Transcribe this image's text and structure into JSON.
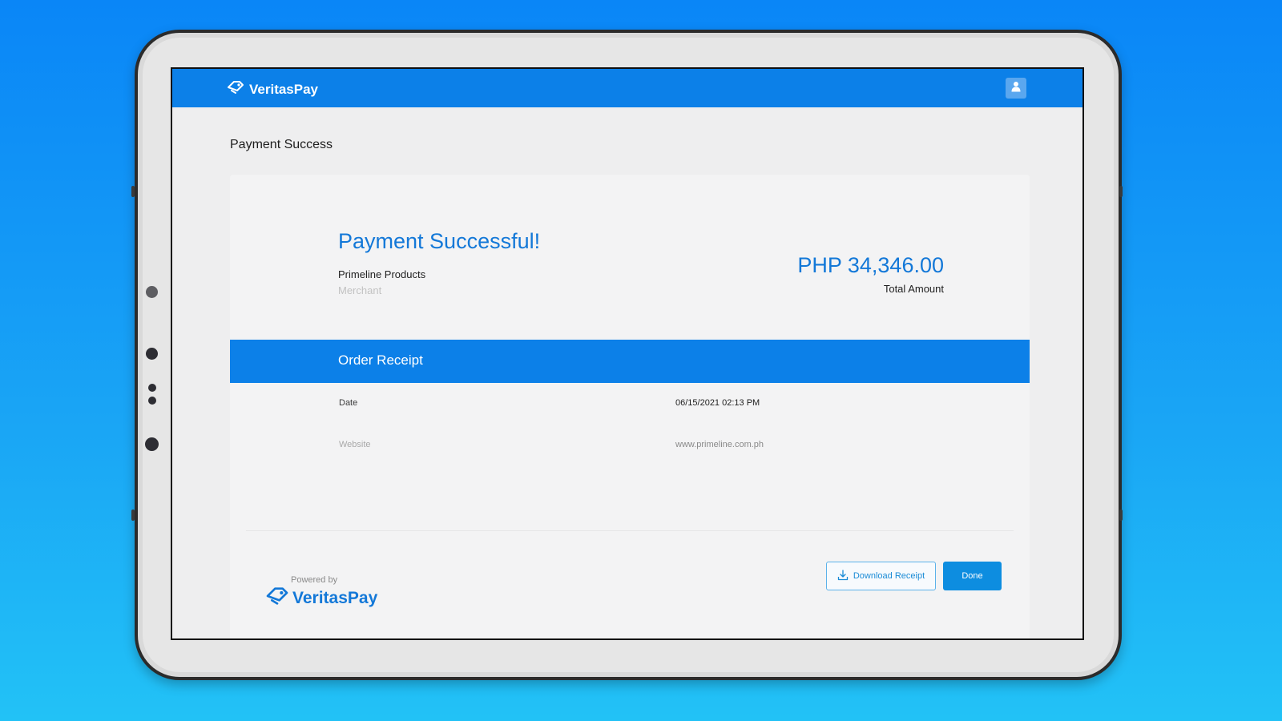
{
  "header": {
    "brand_name": "VeritasPay",
    "user_icon": "user-icon"
  },
  "page": {
    "title": "Payment Success"
  },
  "summary": {
    "headline": "Payment Successful!",
    "merchant_name": "Primeline Products",
    "merchant_label": "Merchant",
    "amount": "PHP 34,346.00",
    "amount_label": "Total Amount"
  },
  "receipt": {
    "title": "Order Receipt",
    "rows": [
      {
        "label": "Date",
        "value": "06/15/2021 02:13 PM"
      },
      {
        "label": "Website",
        "value": "www.primeline.com.ph"
      }
    ]
  },
  "footer": {
    "powered_by": "Powered by",
    "brand_name": "VeritasPay"
  },
  "actions": {
    "download_label": "Download Receipt",
    "download_icon": "download-icon",
    "done_label": "Done"
  },
  "colors": {
    "background_top": "#0a86f7",
    "background_bottom": "#22c2f6",
    "accent": "#0c80e8",
    "headline": "#1378d8"
  }
}
